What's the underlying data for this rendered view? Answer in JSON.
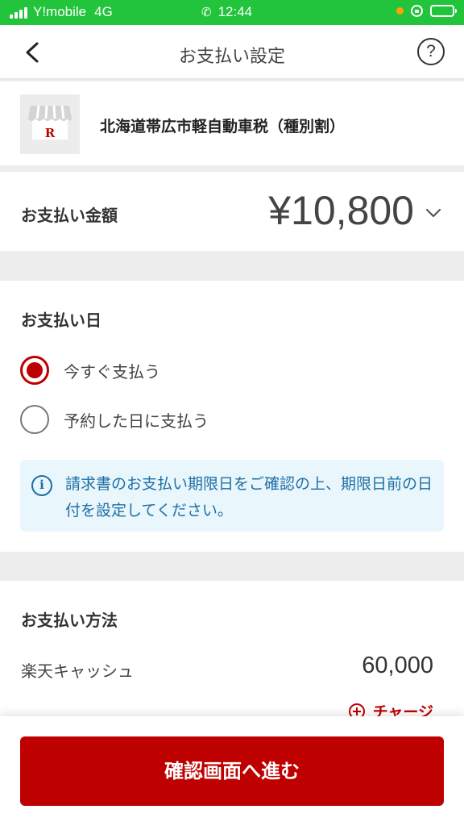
{
  "status_bar": {
    "carrier": "Y!mobile",
    "network": "4G",
    "time": "12:44",
    "colors": {
      "background": "#21c43b",
      "indicator_dot": "#ff9f0a"
    },
    "icons": [
      "signal-icon",
      "phone-icon",
      "orientation-lock-icon",
      "battery-icon"
    ]
  },
  "header": {
    "title": "お支払い設定",
    "help_glyph": "?",
    "icons": [
      "back-chevron-icon",
      "help-icon"
    ]
  },
  "biller": {
    "name": "北海道帯広市軽自動車税（種別割）",
    "logo_icon": "storefront-r-icon"
  },
  "amount": {
    "label": "お支払い金額",
    "value": "¥10,800",
    "expand_icon": "chevron-down-icon"
  },
  "payment_date": {
    "title": "お支払い日",
    "options": [
      {
        "label": "今すぐ支払う",
        "selected": true
      },
      {
        "label": "予約した日に支払う",
        "selected": false
      }
    ],
    "info": {
      "icon": "info-icon",
      "glyph": "i",
      "text": "請求書のお支払い期限日をご確認の上、期限日前の日付を設定してください。"
    }
  },
  "payment_method": {
    "title": "お支払い方法",
    "name": "楽天キャッシュ",
    "balance": "60,000",
    "charge_label": "チャージ",
    "charge_icon": "plus-circle-icon"
  },
  "footer": {
    "confirm_label": "確認画面へ進む"
  },
  "colors": {
    "accent": "#bf0000",
    "info_text": "#1d6fa5",
    "info_background": "#e9f6fc",
    "page_background": "#ededed"
  }
}
